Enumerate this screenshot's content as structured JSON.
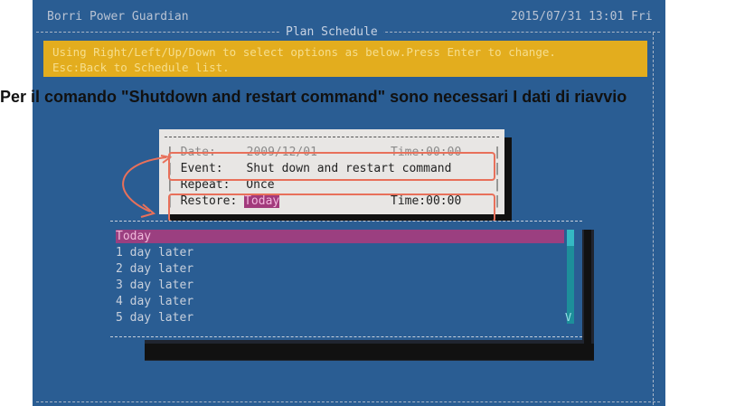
{
  "window": {
    "app_title": "Borri Power Guardian",
    "datetime": "2015/07/31 13:01 Fri",
    "screen_title": "Plan  Schedule"
  },
  "help": {
    "line1": "Using Right/Left/Up/Down to select options as below.Press Enter to change.",
    "line2": "Esc:Back to Schedule list."
  },
  "caption": "Per il comando \"Shutdown and restart command\" sono necessari I dati di riavvio",
  "dialog": {
    "date_label": "Date:",
    "date_value": "2009/12/01",
    "time_label": "Time:",
    "time_value": "00:00",
    "event_label": "Event:",
    "event_value": "Shut down and restart command",
    "repeat_label": "Repeat:",
    "repeat_value": "Once",
    "restore_label": "Restore:",
    "restore_value": "Today",
    "restore_time_label": "Time:",
    "restore_time_value": "00:00"
  },
  "restore_options": [
    "Today",
    "1 day later",
    "2 day later",
    "3 day later",
    "4 day later",
    "5 day later"
  ],
  "colors": {
    "screen_bg": "#2a5d93",
    "help_bar": "#e3ad1e",
    "selection": "#9b3f80",
    "annotation": "#e8705a"
  }
}
